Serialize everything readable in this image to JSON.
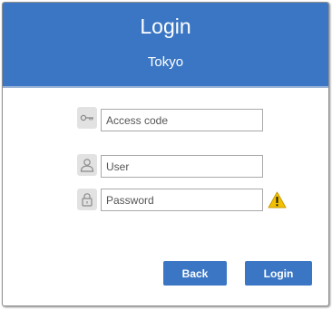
{
  "header": {
    "title": "Login",
    "subtitle": "Tokyo"
  },
  "form": {
    "access_code": {
      "placeholder": "Access code",
      "value": "",
      "icon": "key-icon"
    },
    "user": {
      "placeholder": "User",
      "value": "",
      "icon": "user-icon"
    },
    "password": {
      "placeholder": "Password",
      "value": "",
      "icon": "lock-icon",
      "status_icon": "warning-icon"
    }
  },
  "buttons": {
    "back": "Back",
    "login": "Login"
  },
  "colors": {
    "accent": "#3a76c4",
    "warning": "#f3c000"
  }
}
